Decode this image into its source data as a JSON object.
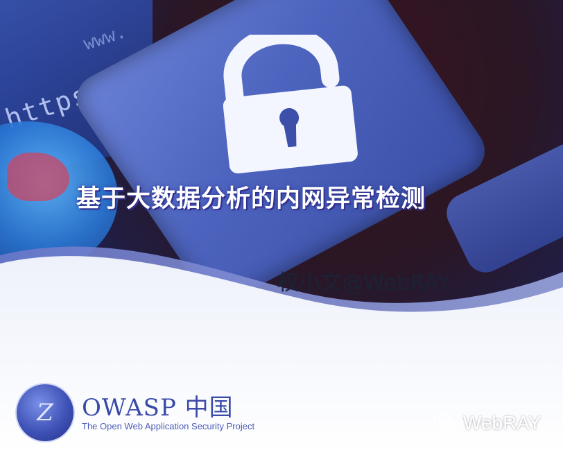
{
  "slide": {
    "background_text_large": "https://",
    "background_text_small": "www.",
    "title": "基于大数据分析的内网异常检测",
    "author": "权小文@WebRAY"
  },
  "owasp": {
    "name": "OWASP 中国",
    "subtitle": "The Open Web Application Security Project"
  },
  "watermark": {
    "text": "WebRAY",
    "icon": "wechat-icon"
  },
  "colors": {
    "title_text": "#ffffff",
    "author_text": "#1c2236",
    "owasp_blue": "#3a4aa8",
    "lock_white": "#f4f6ff",
    "tile_blue": "#5a70cc"
  }
}
